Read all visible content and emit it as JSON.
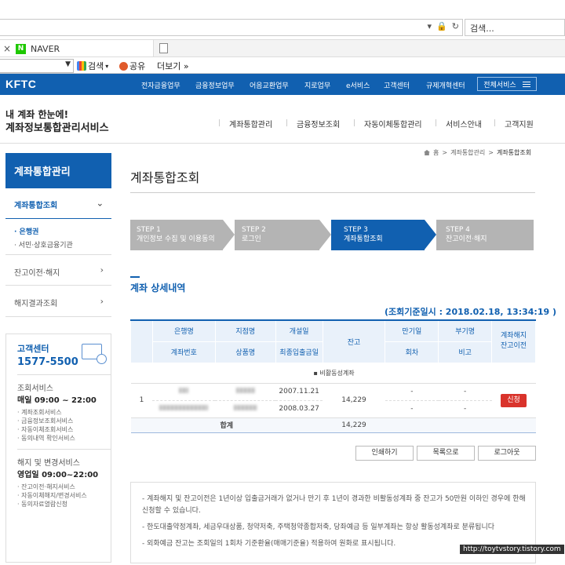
{
  "browser": {
    "search_placeholder": "검색...",
    "tab_title": "NAVER",
    "tab_close": "×",
    "naver_letter": "N",
    "cmd_search": "검색",
    "cmd_share": "공유",
    "cmd_more": "더보기 »"
  },
  "site": {
    "logo": "KFTC",
    "gnb": [
      "전자금융업무",
      "금융정보업무",
      "어음교환업무",
      "지로업무",
      "e서비스",
      "고객센터",
      "규제개혁센터"
    ],
    "all_services": "전체서비스",
    "tagline1": "내 계좌 한눈에!",
    "tagline2": "계좌정보통합관리서비스",
    "menu": [
      "계좌통합관리",
      "금융정보조회",
      "자동이체통합관리",
      "서비스안내",
      "고객지원"
    ]
  },
  "sidebar": {
    "title": "계좌통합관리",
    "items": [
      {
        "label": "계좌통합조회",
        "chevron": "⌄"
      },
      {
        "label": "잔고이전·해지",
        "chevron": "›"
      },
      {
        "label": "해지결과조회",
        "chevron": "›"
      }
    ],
    "sub_items": [
      "· 은행권",
      "· 서민·상호금융기관"
    ],
    "cs": {
      "label": "고객센터",
      "phone": "1577-5500",
      "lookup_title": "조회서비스",
      "lookup_time": "매일 09:00 ~ 22:00",
      "lookup_list": [
        "· 계좌조회서비스",
        "· 금융정보조회서비스",
        "· 자동이체조회서비스",
        "· 동의내역 확인서비스"
      ],
      "change_title": "해지 및 변경서비스",
      "change_time": "영업일 09:00~22:00",
      "change_list": [
        "· 잔고이전·해지서비스",
        "· 자동이체해지/변경서비스",
        "· 동의자료열람신청"
      ]
    }
  },
  "main": {
    "breadcrumb": [
      "홈",
      ">",
      "계좌통합관리",
      ">",
      "계좌통합조회"
    ],
    "title": "계좌통합조회",
    "steps": [
      {
        "num": "STEP 1",
        "label": "개인정보 수집 및 이용동의"
      },
      {
        "num": "STEP 2",
        "label": "로그인"
      },
      {
        "num": "STEP 3",
        "label": "계좌통합조회"
      },
      {
        "num": "STEP 4",
        "label": "잔고이전·해지"
      }
    ],
    "section_title": "계좌 상세내역",
    "ref_date": "(조회기준일시 : 2018.02.18, 13:34:19 )",
    "table": {
      "headers": {
        "bank": "은행명",
        "account_no": "계좌번호",
        "branch": "지점명",
        "product": "상품명",
        "opened": "개설일",
        "last_tx": "최종입출금일",
        "balance": "잔고",
        "maturity": "만기일",
        "installment": "회차",
        "tax": "부기명",
        "note": "비고",
        "action1": "계좌해지",
        "action2": "잔고이전"
      },
      "group": "▪ 비활동성계좌",
      "row": {
        "no": "1",
        "opened": "2007.11.21",
        "last_tx": "2008.03.27",
        "balance": "14,229",
        "maturity": "-",
        "installment": "-",
        "tax": "-",
        "note": "-",
        "action": "신청"
      },
      "total_label": "합계",
      "total_balance": "14,229"
    },
    "buttons": [
      "인쇄하기",
      "목록으로",
      "로그아웃"
    ],
    "notices": [
      "- 계좌해지 및 잔고이전은 1년이상 입출금거래가 없거나 만기 후 1년이 경과한 비활동성계좌 중 잔고가 50만원 이하인 경우에 한해 신청할 수 있습니다.",
      "- 한도대출약정계좌, 세금우대상품, 청약저축, 주택청약종합저축, 당좌예금 등 일부계좌는 항상 활동성계좌로 분류됩니다",
      "- 외화예금 잔고는 조회일의 1회차 기준환율(매매기준율) 적용하여 원화로 표시됩니다."
    ],
    "watermark": "http://toytvstory.tistory.com"
  }
}
